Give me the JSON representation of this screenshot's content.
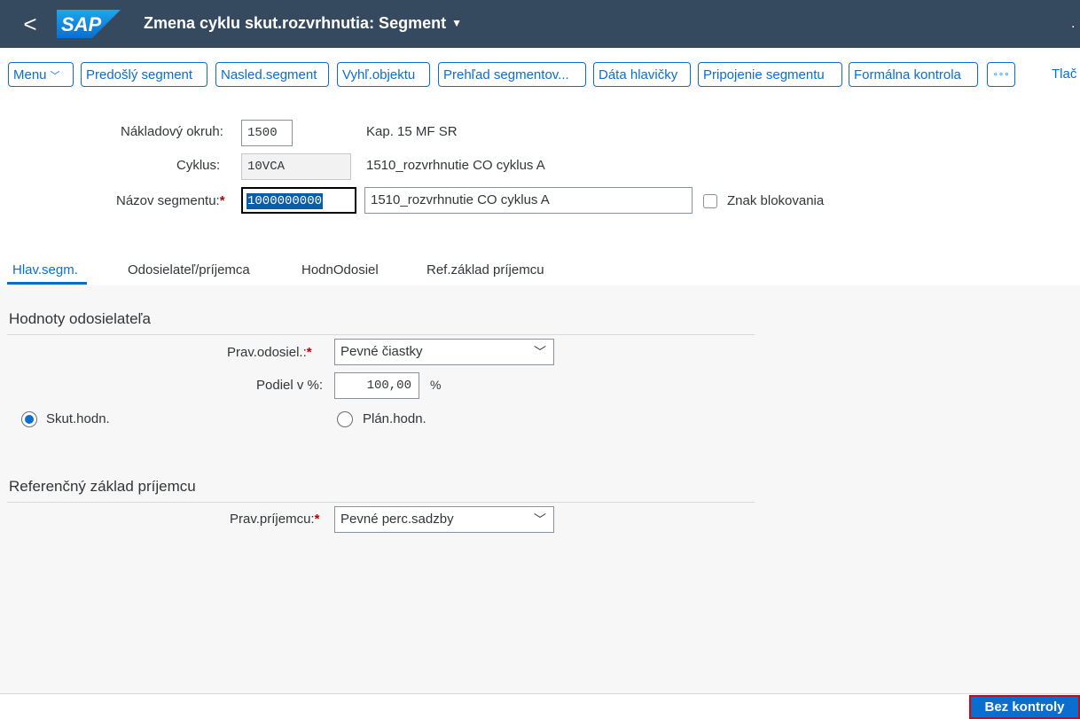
{
  "shell": {
    "back_glyph": "<",
    "logo_text": "SAP",
    "title": "Zmena cyklu skut.rozvrhnutia: Segment",
    "title_caret": "▼"
  },
  "toolbar": {
    "menu_label": "Menu",
    "buttons": [
      "Predošlý segment",
      "Nasled.segment",
      "Vyhľ.objektu",
      "Prehľad segmentov...",
      "Dáta hlavičky",
      "Pripojenie segmentu",
      "Formálna kontrola"
    ],
    "overflow_label": "∘∘∘",
    "cut_off_text": "Tlač"
  },
  "header": {
    "cost_area_label": "Nákladový okruh:",
    "cost_area_value": "1500",
    "cost_area_desc": "Kap. 15 MF SR",
    "cycle_label": "Cyklus:",
    "cycle_value": "10VCA",
    "cycle_desc": "1510_rozvrhnutie CO cyklus A",
    "segment_label": "Názov segmentu:",
    "required_mark": "*",
    "segment_value": "1000000000",
    "segment_desc": "1510_rozvrhnutie CO cyklus A",
    "block_label": "Znak blokovania"
  },
  "tabs": [
    {
      "label": "Hlav.segm.",
      "active": true
    },
    {
      "label": "Odosielateľ/príjemca",
      "active": false
    },
    {
      "label": "HodnOdosiel",
      "active": false
    },
    {
      "label": "Ref.základ príjemcu",
      "active": false
    }
  ],
  "sender": {
    "section_title": "Hodnoty odosielateľa",
    "rule_label": "Prav.odosiel.:",
    "rule_value": "Pevné čiastky",
    "share_label": "Podiel v %:",
    "share_value": "100,00",
    "share_unit": "%",
    "actual_label": "Skut.hodn.",
    "plan_label": "Plán.hodn.",
    "actual_selected": true
  },
  "receiver": {
    "section_title": "Referenčný základ príjemcu",
    "rule_label": "Prav.príjemcu:",
    "rule_value": "Pevné perc.sadzby"
  },
  "footer": {
    "button_label": "Bez kontroly"
  },
  "colors": {
    "shell_bg": "#354a5f",
    "accent": "#0a6ed1",
    "required": "#bb0000",
    "highlight_border": "#e00000"
  }
}
